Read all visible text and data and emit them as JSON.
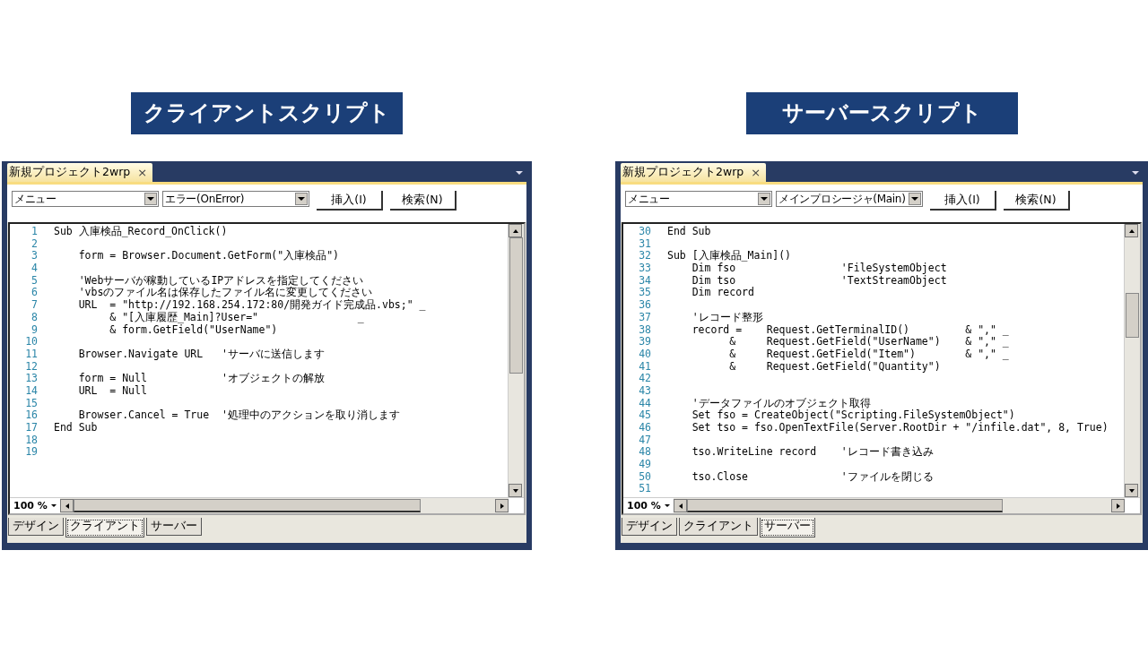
{
  "panels": [
    {
      "heading": "クライアントスクリプト",
      "window": {
        "tab": {
          "title": "新規プロジェクト2wrp",
          "close": "×"
        },
        "menus": [
          {
            "value": "メニュー"
          },
          {
            "value": "エラー(OnError)"
          }
        ],
        "buttons": [
          "挿入(I)",
          "検索(N)"
        ],
        "code": [
          {
            "number": "1",
            "text": "Sub 入庫検品_Record_OnClick()"
          },
          {
            "number": "2"
          },
          {
            "number": "3",
            "text": "    form = Browser.Document.GetForm(\"入庫検品\")"
          },
          {
            "number": "4"
          },
          {
            "number": "5",
            "text": "    'Webサーバが稼動しているIPアドレスを指定してください"
          },
          {
            "number": "6",
            "text": "    'vbsのファイル名は保存したファイル名に変更してください"
          },
          {
            "number": "7",
            "text": "    URL  = \"http://192.168.254.172:80/開発ガイド完成品.vbs;\" _"
          },
          {
            "number": "8",
            "text": "         & \"[入庫履歴_Main]?User=\"                _"
          },
          {
            "number": "9",
            "text": "         & form.GetField(\"UserName\")"
          },
          {
            "number": "10"
          },
          {
            "number": "11",
            "text": "    Browser.Navigate URL   'サーバに送信します"
          },
          {
            "number": "12"
          },
          {
            "number": "13",
            "text": "    form = Null            'オブジェクトの解放"
          },
          {
            "number": "14",
            "text": "    URL  = Null"
          },
          {
            "number": "15"
          },
          {
            "number": "16",
            "text": "    Browser.Cancel = True  '処理中のアクションを取り消します"
          },
          {
            "number": "17",
            "text": "End Sub"
          },
          {
            "number": "18"
          },
          {
            "number": "19"
          }
        ],
        "zoom": "100 %",
        "view_tabs": [
          {
            "label": "デザイン",
            "selected": false
          },
          {
            "label": "クライアント",
            "selected": true
          },
          {
            "label": "サーバー",
            "selected": false
          }
        ]
      }
    },
    {
      "heading": "サーバースクリプト",
      "window": {
        "tab": {
          "title": "新規プロジェクト2wrp",
          "close": "×"
        },
        "menus": [
          {
            "value": "メニュー"
          },
          {
            "value": "メインプロシージャ(Main)"
          }
        ],
        "buttons": [
          "挿入(I)",
          "検索(N)"
        ],
        "code": [
          {
            "number": "30",
            "text": "End Sub"
          },
          {
            "number": "31"
          },
          {
            "number": "32",
            "text": "Sub [入庫検品_Main]()"
          },
          {
            "number": "33",
            "text": "    Dim fso                 'FileSystemObject"
          },
          {
            "number": "34",
            "text": "    Dim tso                 'TextStreamObject"
          },
          {
            "number": "35",
            "text": "    Dim record"
          },
          {
            "number": "36"
          },
          {
            "number": "37",
            "text": "    'レコード整形"
          },
          {
            "number": "38",
            "text": "    record =    Request.GetTerminalID()         & \",\" _"
          },
          {
            "number": "39",
            "text": "          &     Request.GetField(\"UserName\")    & \",\" _"
          },
          {
            "number": "40",
            "text": "          &     Request.GetField(\"Item\")        & \",\" _"
          },
          {
            "number": "41",
            "text": "          &     Request.GetField(\"Quantity\")"
          },
          {
            "number": "42"
          },
          {
            "number": "43"
          },
          {
            "number": "44",
            "text": "    'データファイルのオブジェクト取得"
          },
          {
            "number": "45",
            "text": "    Set fso = CreateObject(\"Scripting.FileSystemObject\")"
          },
          {
            "number": "46",
            "text": "    Set tso = fso.OpenTextFile(Server.RootDir + \"/infile.dat\", 8, True)"
          },
          {
            "number": "47"
          },
          {
            "number": "48",
            "text": "    tso.WriteLine record    'レコード書き込み"
          },
          {
            "number": "49"
          },
          {
            "number": "50",
            "text": "    tso.Close               'ファイルを閉じる"
          },
          {
            "number": "51"
          }
        ],
        "zoom": "100 %",
        "view_tabs": [
          {
            "label": "デザイン",
            "selected": false
          },
          {
            "label": "クライアント",
            "selected": false
          },
          {
            "label": "サーバー",
            "selected": true
          }
        ]
      }
    }
  ]
}
